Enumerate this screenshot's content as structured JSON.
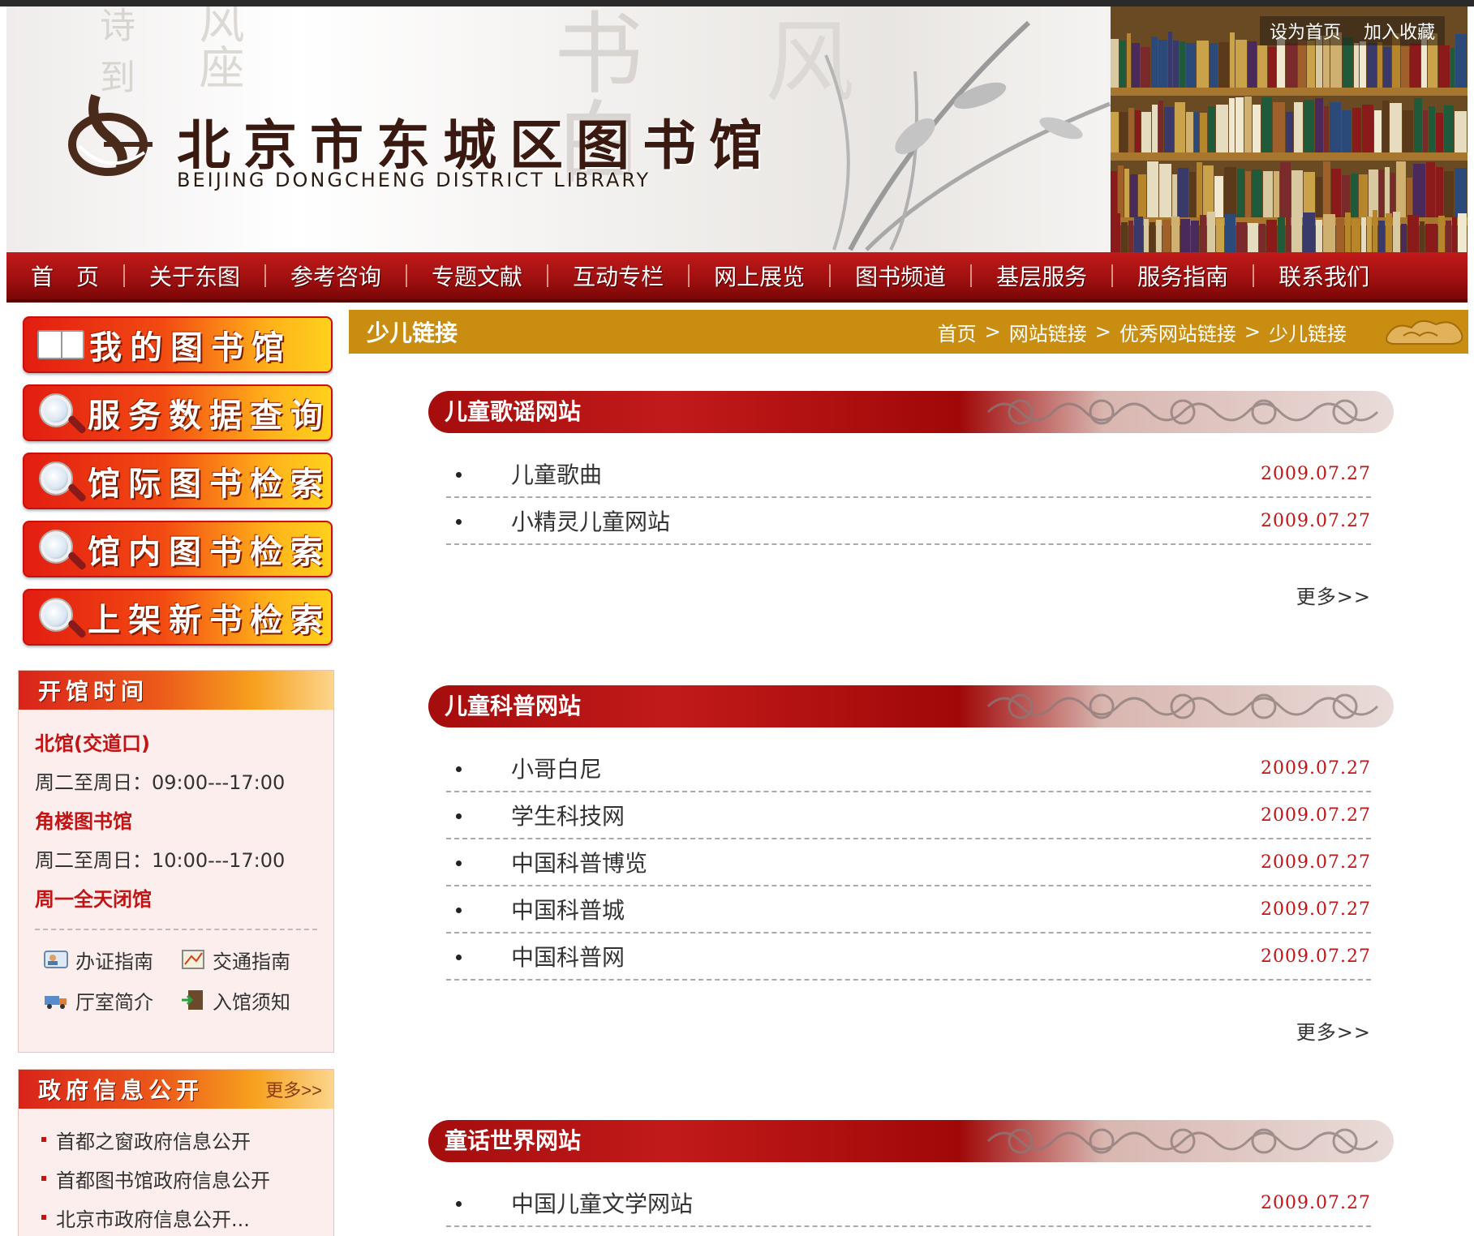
{
  "header": {
    "title": "北京市东城区图书馆",
    "subtitle": "BEIJING DONGCHENG DISTRICT LIBRARY",
    "set_homepage": "设为首页",
    "add_favorite": "加入收藏"
  },
  "nav": {
    "items": [
      "首　页",
      "关于东图",
      "参考咨询",
      "专题文献",
      "互动专栏",
      "网上展览",
      "图书频道",
      "基层服务",
      "服务指南",
      "联系我们"
    ]
  },
  "sidebar": {
    "buttons": [
      {
        "label": "我的图书馆",
        "icon": "book-icon"
      },
      {
        "label": "服务数据查询",
        "icon": "magnifier-icon"
      },
      {
        "label": "馆际图书检索",
        "icon": "magnifier-icon"
      },
      {
        "label": "馆内图书检索",
        "icon": "magnifier-icon"
      },
      {
        "label": "上架新书检索",
        "icon": "magnifier-icon"
      }
    ],
    "hours": {
      "title": "开馆时间",
      "branch1": "北馆(交道口)",
      "branch1_hours": "周二至周日：09:00---17:00",
      "branch2": "角楼图书馆",
      "branch2_hours": "周二至周日：10:00---17:00",
      "closed": "周一全天闭馆",
      "guides": [
        {
          "label": "办证指南",
          "icon": "id-card-icon"
        },
        {
          "label": "交通指南",
          "icon": "map-icon"
        },
        {
          "label": "厅室简介",
          "icon": "truck-icon"
        },
        {
          "label": "入馆须知",
          "icon": "door-icon"
        }
      ]
    },
    "gov": {
      "title": "政府信息公开",
      "more": "更多>>",
      "items": [
        "首都之窗政府信息公开",
        "首都图书馆政府信息公开",
        "北京市政府信息公开..."
      ]
    }
  },
  "main": {
    "title": "少儿链接",
    "breadcrumb": [
      "首页",
      ">",
      "网站链接",
      ">",
      "优秀网站链接",
      ">",
      "少儿链接"
    ],
    "more_label": "更多>>",
    "sections": [
      {
        "title": "儿童歌谣网站",
        "items": [
          {
            "title": "儿童歌曲",
            "date": "2009.07.27"
          },
          {
            "title": "小精灵儿童网站",
            "date": "2009.07.27"
          }
        ]
      },
      {
        "title": "儿童科普网站",
        "items": [
          {
            "title": "小哥白尼",
            "date": "2009.07.27"
          },
          {
            "title": "学生科技网",
            "date": "2009.07.27"
          },
          {
            "title": "中国科普博览",
            "date": "2009.07.27"
          },
          {
            "title": "中国科普城",
            "date": "2009.07.27"
          },
          {
            "title": "中国科普网",
            "date": "2009.07.27"
          }
        ]
      },
      {
        "title": "童话世界网站",
        "items": [
          {
            "title": "中国儿童文学网站",
            "date": "2009.07.27"
          }
        ]
      }
    ]
  },
  "colors": {
    "nav_red": "#a50d0d",
    "accent_gold": "#c98d12",
    "date_red": "#c21414"
  }
}
